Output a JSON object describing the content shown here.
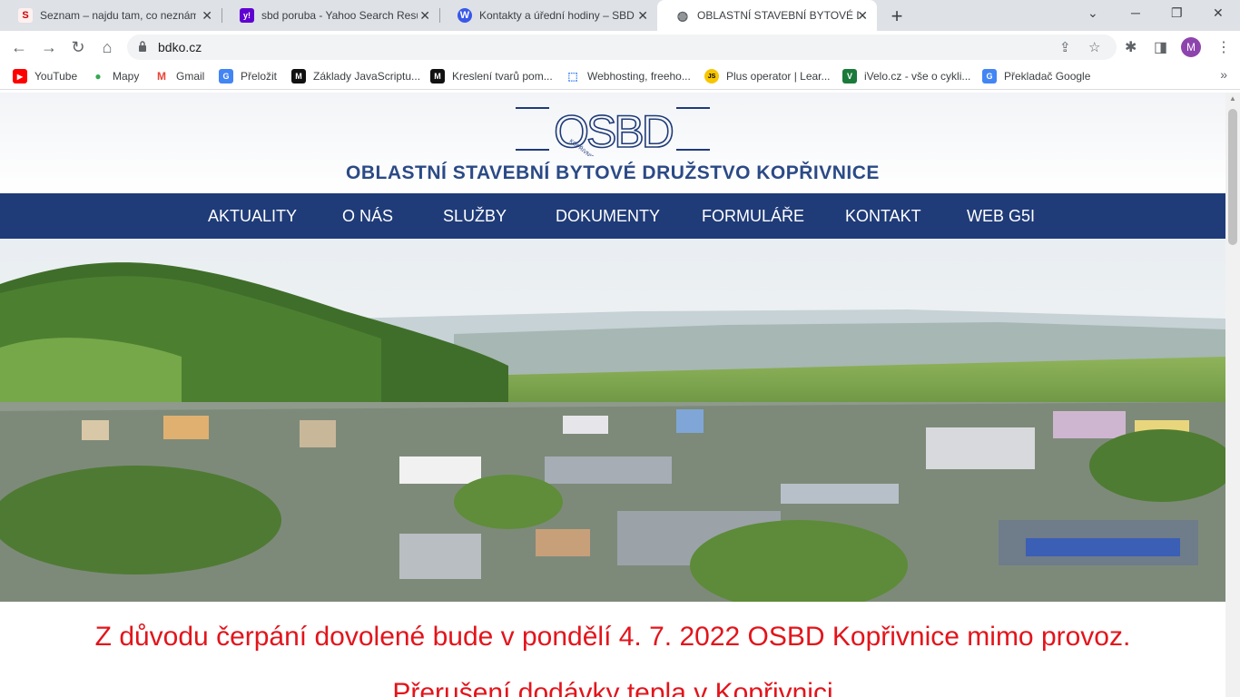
{
  "tabs": [
    {
      "title": "Seznam – najdu tam, co neznám",
      "favicon": "seznam-icon",
      "favicon_glyph": "S",
      "favicon_color": "#cc0000",
      "favicon_bg": "#fff0f0"
    },
    {
      "title": "sbd poruba - Yahoo Search Resul",
      "favicon": "yahoo-icon",
      "favicon_glyph": "y!",
      "favicon_color": "#ffffff",
      "favicon_bg": "#6001d2"
    },
    {
      "title": "Kontakty a úřední hodiny – SBD P",
      "favicon": "wordpress-icon",
      "favicon_glyph": "W",
      "favicon_color": "#ffffff",
      "favicon_bg": "#3858e9"
    },
    {
      "title": "OBLASTNÍ STAVEBNÍ BYTOVÉ DR",
      "favicon": "globe-icon",
      "favicon_glyph": "◍",
      "favicon_color": "#5f6368",
      "favicon_bg": "transparent",
      "active": true
    }
  ],
  "toolbar": {
    "url": "bdko.cz",
    "avatar_letter": "M"
  },
  "bookmarks": [
    {
      "label": "YouTube",
      "icon": "youtube-icon",
      "glyph": "▶",
      "color": "#ffffff",
      "bg": "#ff0000"
    },
    {
      "label": "Mapy",
      "icon": "google-maps-icon",
      "glyph": "●",
      "color": "#34a853",
      "bg": "transparent"
    },
    {
      "label": "Gmail",
      "icon": "gmail-icon",
      "glyph": "M",
      "color": "#ea4335",
      "bg": "transparent"
    },
    {
      "label": "Přeložit",
      "icon": "google-translate-icon",
      "glyph": "G",
      "color": "#ffffff",
      "bg": "#4285f4"
    },
    {
      "label": "Základy JavaScriptu...",
      "icon": "m-icon",
      "glyph": "M",
      "color": "#ffffff",
      "bg": "#111111"
    },
    {
      "label": "Kreslení tvarů pom...",
      "icon": "m-icon",
      "glyph": "M",
      "color": "#ffffff",
      "bg": "#111111"
    },
    {
      "label": "Webhosting, freeho...",
      "icon": "webhosting-icon",
      "glyph": "⬚",
      "color": "#4285f4",
      "bg": "transparent"
    },
    {
      "label": "Plus operator | Lear...",
      "icon": "js-icon",
      "glyph": "JS",
      "color": "#000000",
      "bg": "#f7c600"
    },
    {
      "label": "iVelo.cz - vše o cykli...",
      "icon": "ivelo-icon",
      "glyph": "V",
      "color": "#ffffff",
      "bg": "#1a7a3a"
    },
    {
      "label": "Překladač Google",
      "icon": "google-translate-icon",
      "glyph": "G",
      "color": "#ffffff",
      "bg": "#4285f4"
    }
  ],
  "site": {
    "logo_text": "OSBD",
    "logo_small_text": "KOPŘIVNICE",
    "subtitle": "OBLASTNÍ STAVEBNÍ BYTOVÉ DRUŽSTVO KOPŘIVNICE",
    "nav": [
      "AKTUALITY",
      "O NÁS",
      "SLUŽBY",
      "DOKUMENTY",
      "FORMULÁŘE",
      "KONTAKT",
      "WEB G5I"
    ],
    "announcement_1": "Z důvodu čerpání dovolené bude v pondělí 4. 7. 2022 OSBD Kopřivnice mimo provoz.",
    "announcement_2": "Přerušení dodávky tepla v Kopřivnici"
  },
  "colors": {
    "nav_bg": "#1f3b78",
    "brand": "#2b4a86",
    "announcement": "#e3141b"
  }
}
